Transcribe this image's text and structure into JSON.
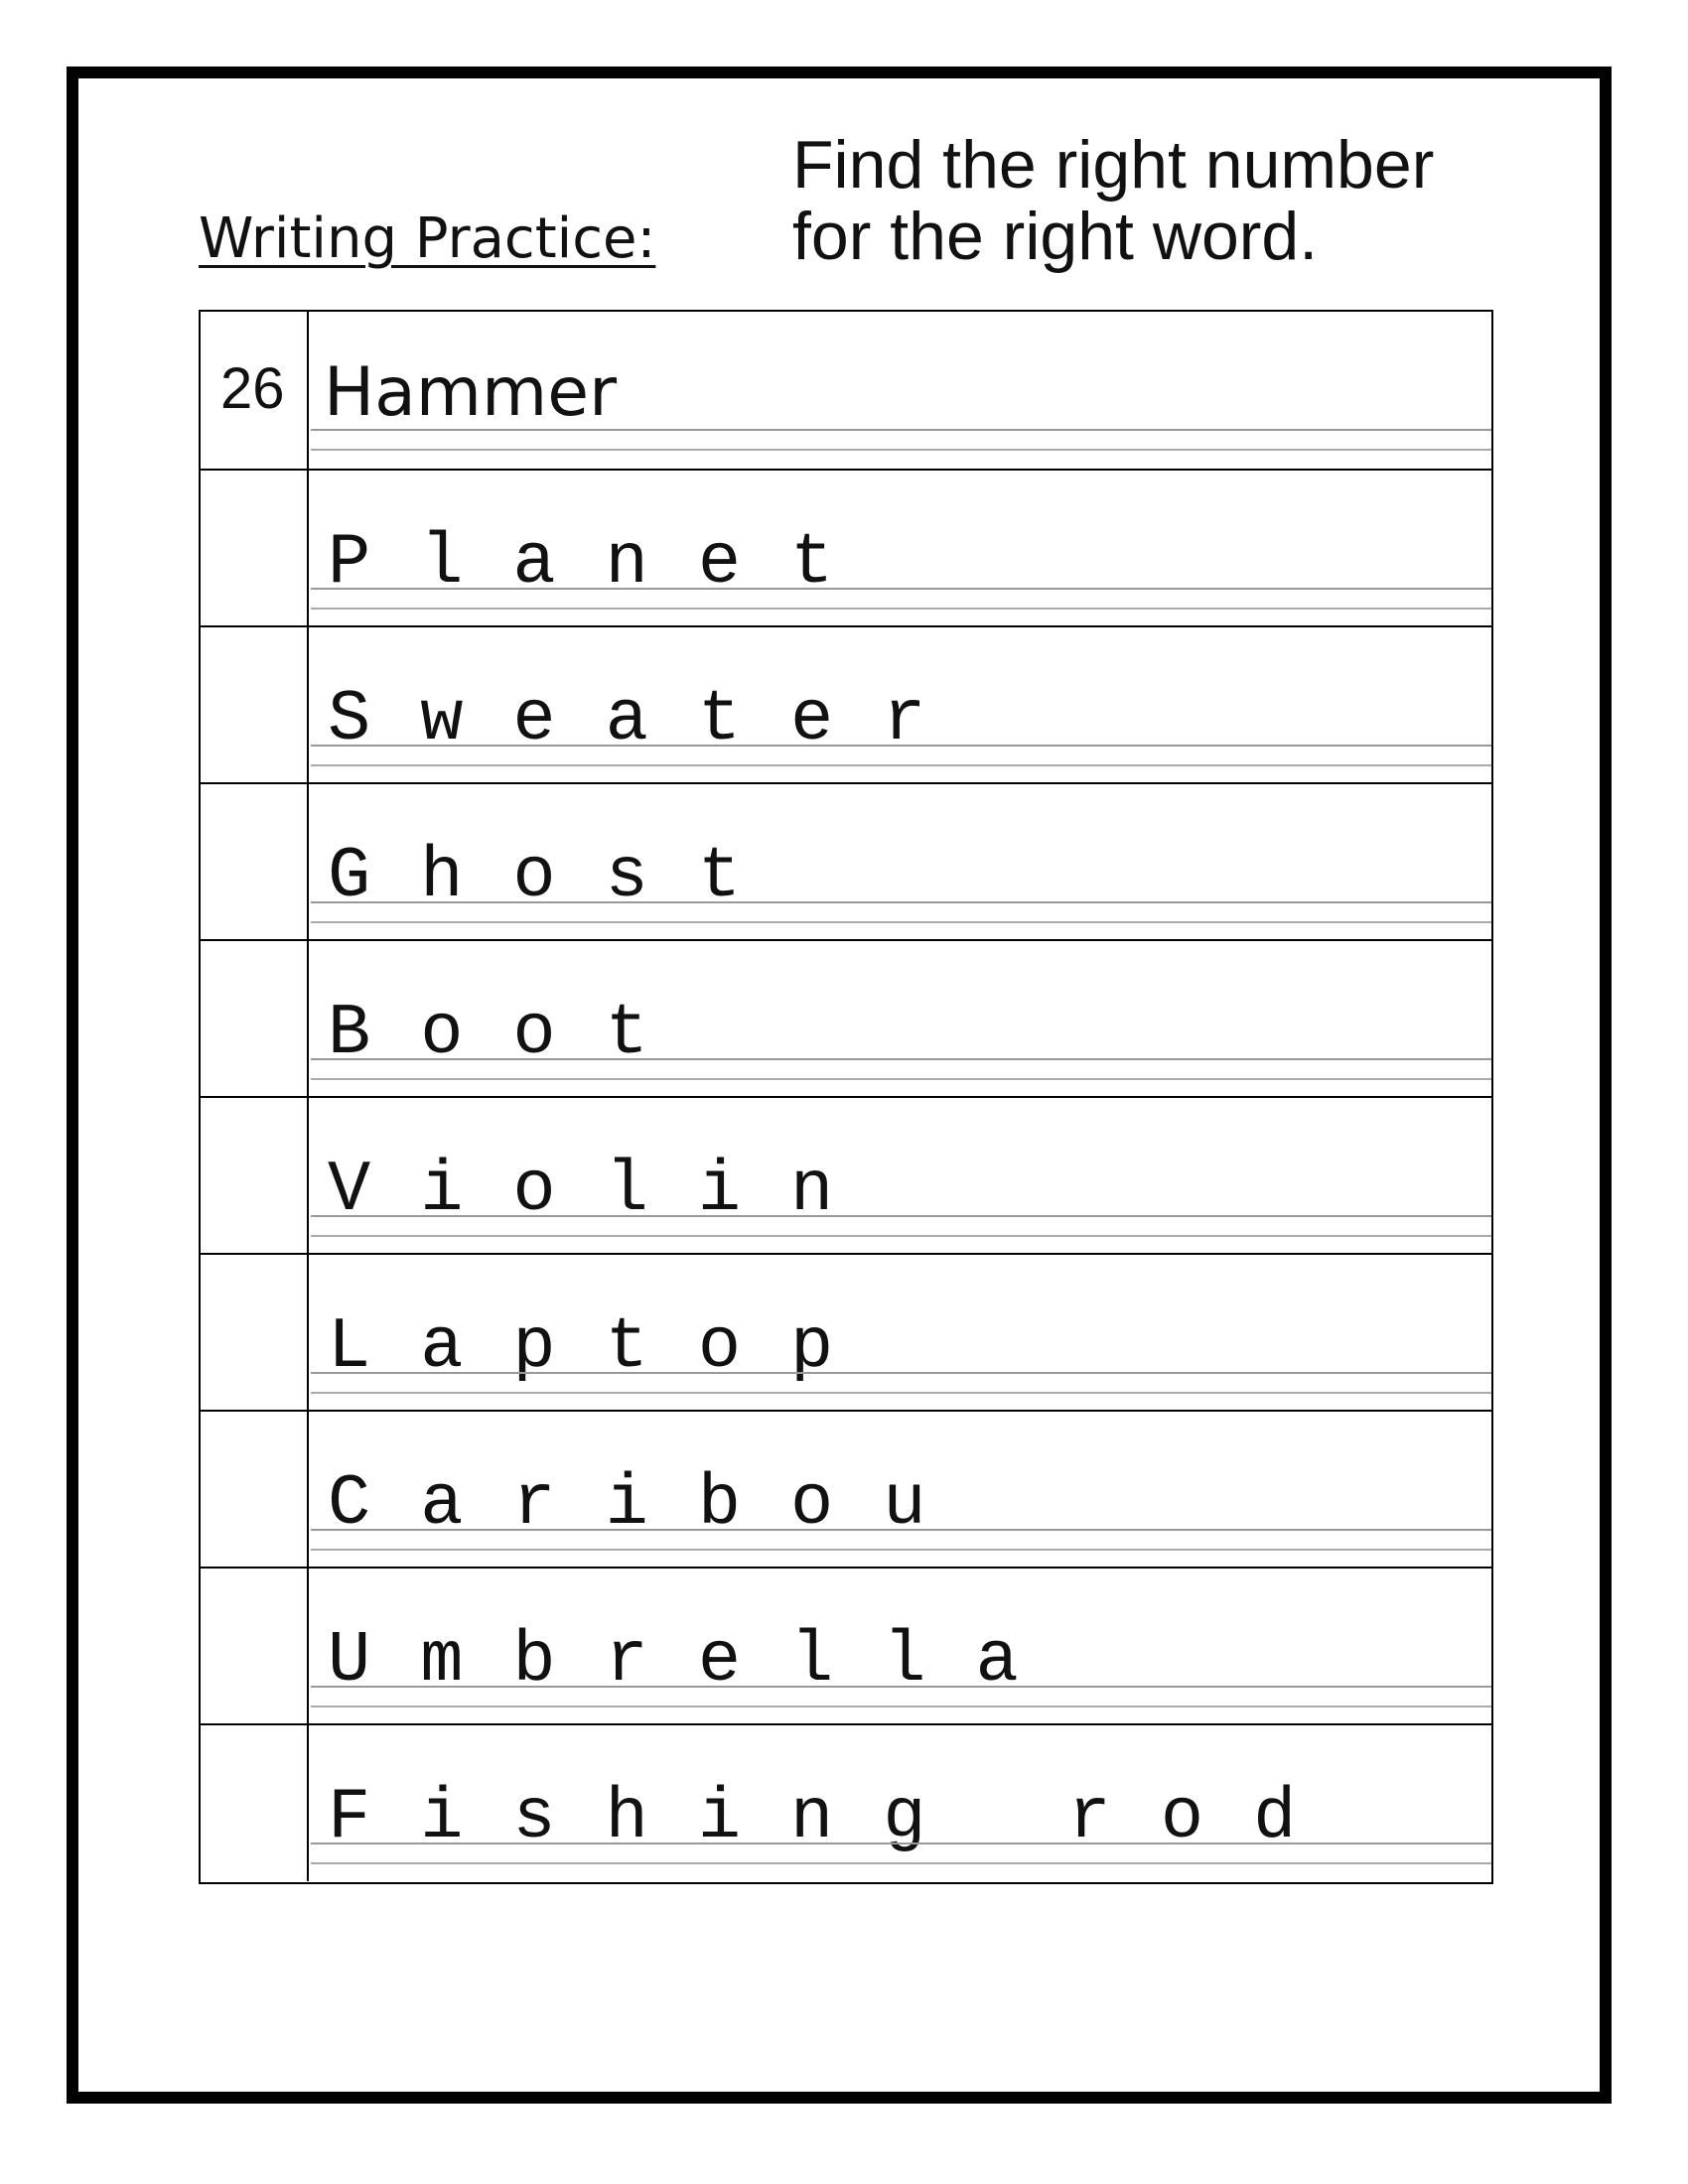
{
  "heading": "Writing Practice:",
  "instruction_line1": "Find the right number",
  "instruction_line2": "for the right word.",
  "rows": [
    {
      "number": "26",
      "word": "Hammer"
    },
    {
      "number": "",
      "word": "Planet"
    },
    {
      "number": "",
      "word": "Sweater"
    },
    {
      "number": "",
      "word": "Ghost"
    },
    {
      "number": "",
      "word": "Boot"
    },
    {
      "number": "",
      "word": "Violin"
    },
    {
      "number": "",
      "word": "Laptop"
    },
    {
      "number": "",
      "word": "Caribou"
    },
    {
      "number": "",
      "word": "Umbrella"
    },
    {
      "number": "",
      "word": "Fishing rod"
    }
  ]
}
